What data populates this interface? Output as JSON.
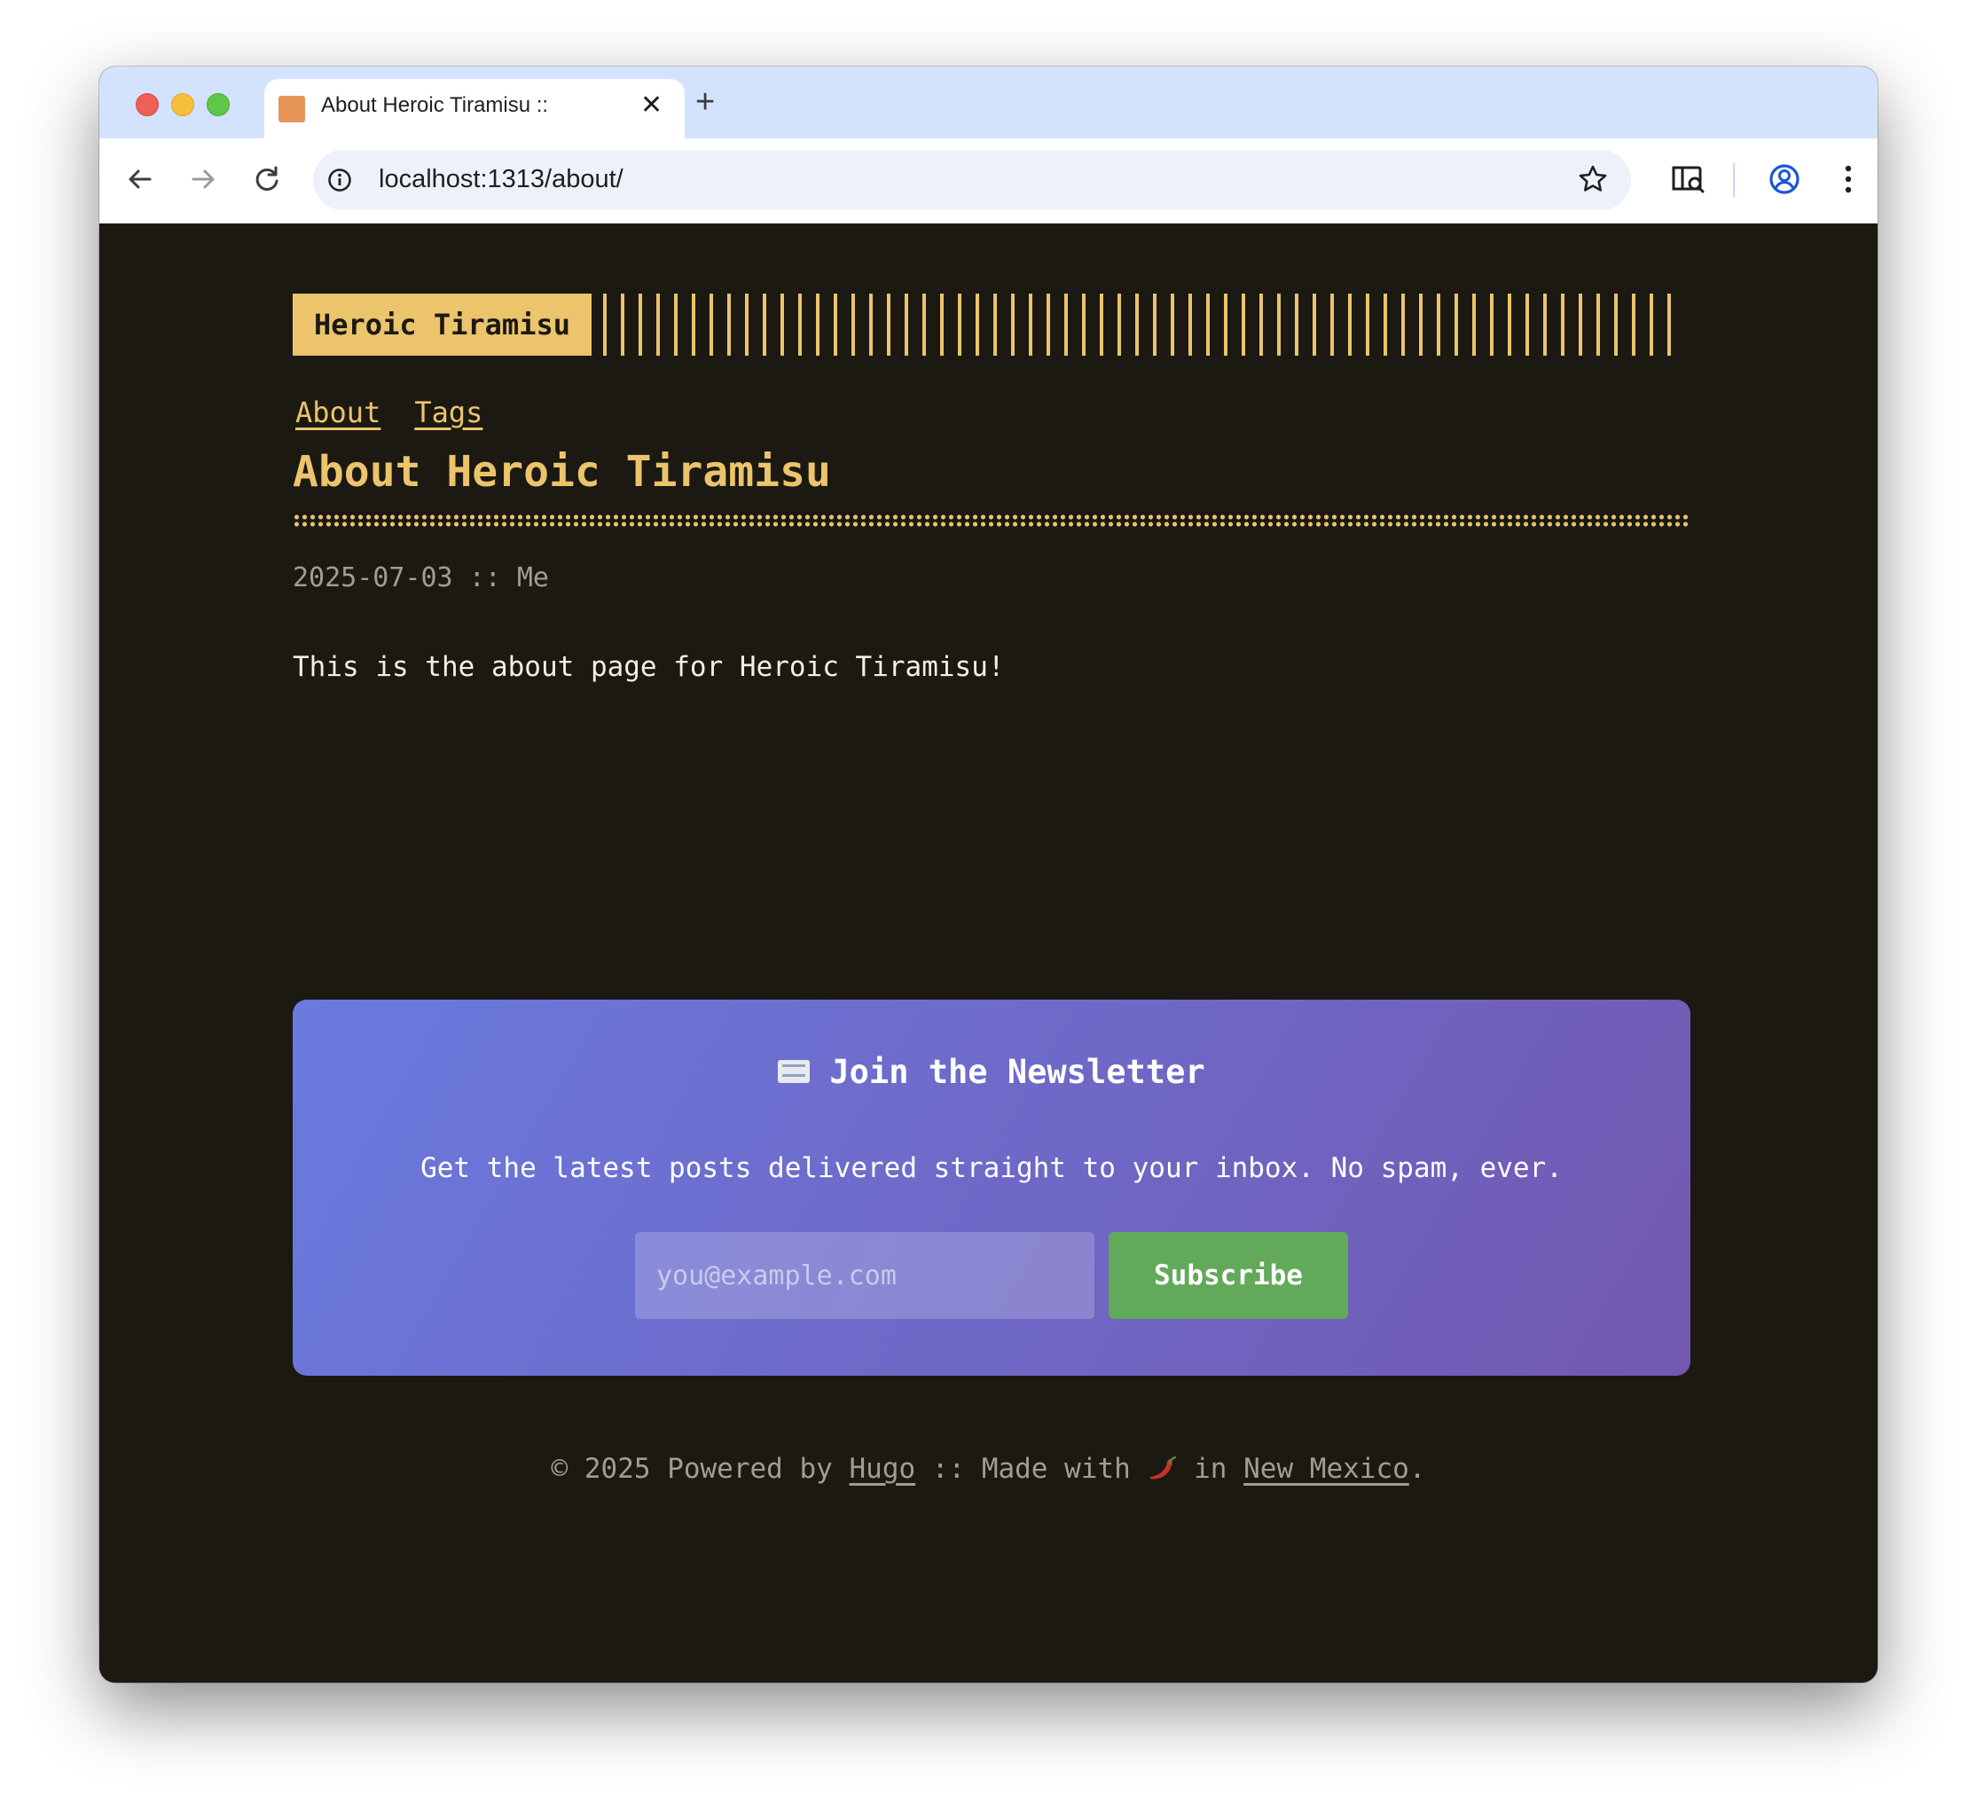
{
  "browser": {
    "tab_title": "About Heroic Tiramisu ::",
    "url": "localhost:1313/about/"
  },
  "site": {
    "logo": "Heroic Tiramisu",
    "menu": [
      "About",
      "Tags"
    ],
    "accent_color": "#ebc46b",
    "background_color": "#1c1913"
  },
  "post": {
    "title": "About Heroic Tiramisu",
    "date": "2025-07-03",
    "separator": "::",
    "author": "Me",
    "body": "This is the about page for Heroic Tiramisu!"
  },
  "newsletter": {
    "icon": "envelope-icon",
    "title": "Join the Newsletter",
    "text": "Get the latest posts delivered straight to your inbox. No spam, ever.",
    "input_placeholder": "you@example.com",
    "button_label": "Subscribe",
    "gradient": [
      "#6a7adf",
      "#7258b0"
    ],
    "button_color": "#63a95a"
  },
  "footer": {
    "copyright": "© 2025 Powered by",
    "hugo_link": "Hugo",
    "made_with": ":: Made with",
    "chili_icon": "chili-pepper-icon",
    "in_text": "in",
    "location_link": "New Mexico",
    "end": "."
  }
}
